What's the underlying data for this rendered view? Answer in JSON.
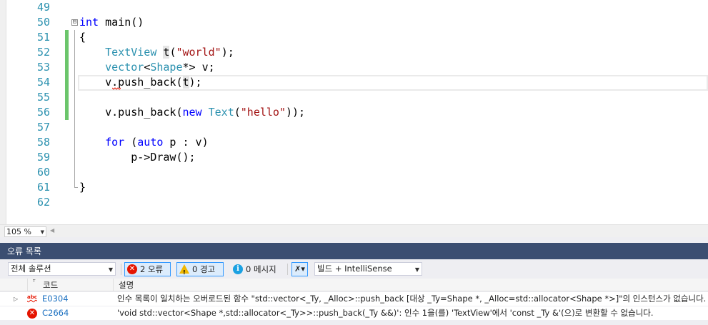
{
  "editor": {
    "lines": [
      {
        "num": "49",
        "code": "",
        "changed": false
      },
      {
        "num": "50",
        "code": "int main()",
        "changed": false,
        "fold": "⊟"
      },
      {
        "num": "51",
        "code": "{",
        "changed": true
      },
      {
        "num": "52",
        "code": "    TextView t(\"world\");",
        "changed": true
      },
      {
        "num": "53",
        "code": "    vector<Shape*> v;",
        "changed": true
      },
      {
        "num": "54",
        "code": "    v.push_back(t);",
        "changed": true
      },
      {
        "num": "55",
        "code": "",
        "changed": true
      },
      {
        "num": "56",
        "code": "    v.push_back(new Text(\"hello\"));",
        "changed": true
      },
      {
        "num": "57",
        "code": "",
        "changed": false
      },
      {
        "num": "58",
        "code": "    for (auto p : v)",
        "changed": false
      },
      {
        "num": "59",
        "code": "        p->Draw();",
        "changed": false
      },
      {
        "num": "60",
        "code": "",
        "changed": false
      },
      {
        "num": "61",
        "code": "}",
        "changed": false
      },
      {
        "num": "62",
        "code": "",
        "changed": false
      }
    ]
  },
  "zoom": {
    "value": "105 %"
  },
  "error_list": {
    "title": "오류 목록",
    "scope": "전체 솔루션",
    "errors_label": "2 오류",
    "warnings_label": "0 경고",
    "messages_label": "0 메시지",
    "source_filter": "빌드 + IntelliSense",
    "columns": {
      "code": "코드",
      "description": "설명"
    },
    "rows": [
      {
        "code": "E0304",
        "icon": "abc-squiggle-icon",
        "description": "인수 목록이 일치하는 오버로드된 함수 \"std::vector<_Ty, _Alloc>::push_back [대상 _Ty=Shape *, _Alloc=std::allocator<Shape *>]\"의 인스턴스가 없습니다."
      },
      {
        "code": "C2664",
        "icon": "error-circle-icon",
        "description": "'void std::vector<Shape *,std::allocator<_Ty>>::push_back(_Ty &&)': 인수 1을(를) 'TextView'에서 'const _Ty &'(으)로 변환할 수 없습니다."
      }
    ]
  },
  "colors": {
    "title_bar": "#3b4e71",
    "change_bar": "#6bc56b",
    "error": "#e51400",
    "line_number": "#2b91af"
  }
}
